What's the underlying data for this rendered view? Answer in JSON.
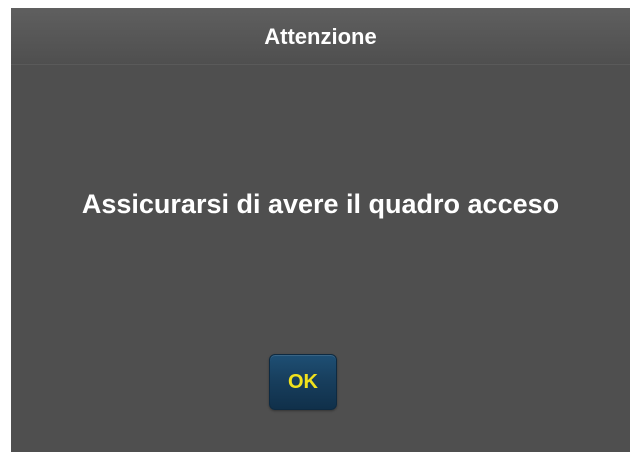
{
  "dialog": {
    "title": "Attenzione",
    "message": "Assicurarsi di avere il quadro acceso",
    "ok_label": "OK"
  },
  "colors": {
    "dialog_background": "#4f4f4f",
    "header_background": "#5a5a5a",
    "text": "#ffffff",
    "button_background": "#183f5e",
    "button_text": "#f2e21c"
  }
}
